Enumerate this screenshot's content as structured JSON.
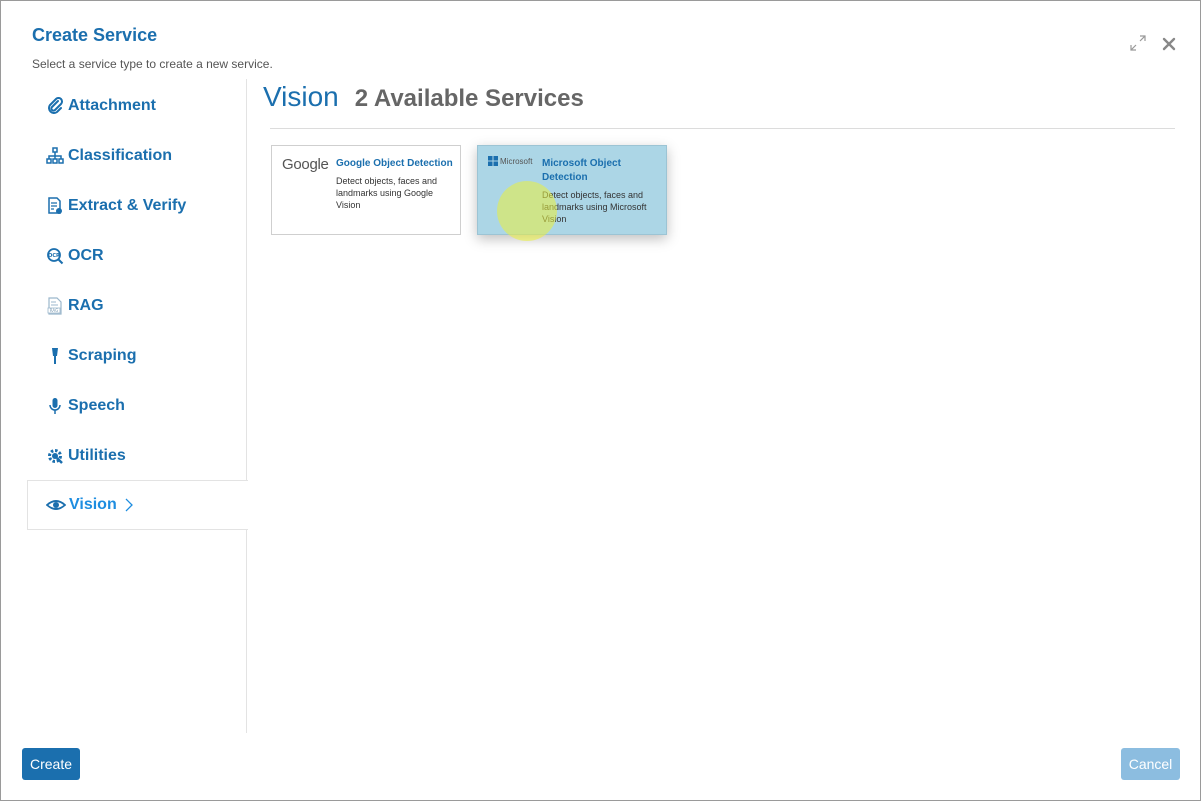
{
  "dialog": {
    "title": "Create Service",
    "subtitle": "Select a service type to create a new service."
  },
  "sidebar": {
    "items": [
      {
        "label": "Attachment",
        "icon": "paperclip-icon"
      },
      {
        "label": "Classification",
        "icon": "hierarchy-icon"
      },
      {
        "label": "Extract & Verify",
        "icon": "document-check-icon"
      },
      {
        "label": "OCR",
        "icon": "ocr-search-icon"
      },
      {
        "label": "RAG",
        "icon": "rag-file-icon"
      },
      {
        "label": "Scraping",
        "icon": "brush-icon"
      },
      {
        "label": "Speech",
        "icon": "microphone-icon"
      },
      {
        "label": "Utilities",
        "icon": "gear-wrench-icon"
      },
      {
        "label": "Vision",
        "icon": "eye-icon",
        "active": true
      }
    ]
  },
  "main": {
    "category": "Vision",
    "count_label": "2 Available Services",
    "cards": [
      {
        "logo": "Google",
        "title": "Google Object Detection",
        "description": "Detect objects, faces and landmarks using Google Vision"
      },
      {
        "logo": "Microsoft",
        "title": "Microsoft Object Detection",
        "description": "Detect objects, faces and landmarks using Microsoft Vision"
      }
    ]
  },
  "footer": {
    "create_label": "Create",
    "cancel_label": "Cancel"
  },
  "colors": {
    "primary": "#1b6fae",
    "active_link": "#1d8de0",
    "selected_card": "#acd6e6",
    "cancel_disabled": "#8cbde0"
  }
}
